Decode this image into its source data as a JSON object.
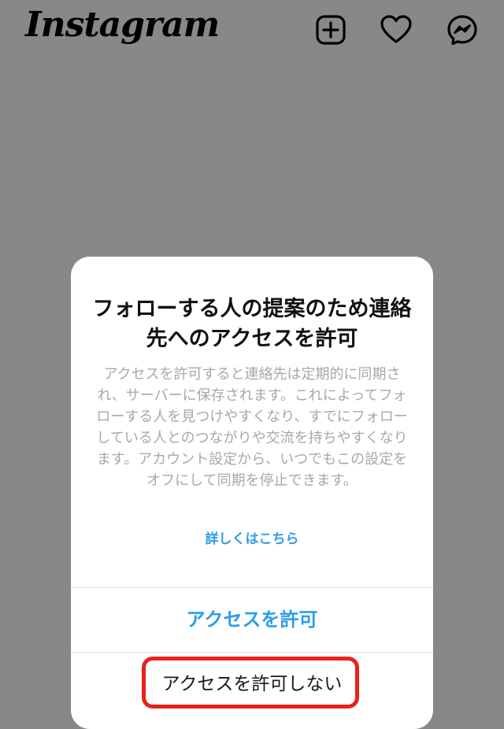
{
  "header": {
    "logo": "Instagram",
    "icons": {
      "new_post": "plus-square-icon",
      "activity": "heart-icon",
      "messages": "messenger-icon"
    }
  },
  "dialog": {
    "title": "フォローする人の提案のため連絡先へのアクセスを許可",
    "body": "アクセスを許可すると連絡先は定期的に同期され、サーバーに保存されます。これによってフォローする人を見つけやすくなり、すでにフォローしている人とのつながりや交流を持ちやすくなります。アカウント設定から、いつでもこの設定をオフにして同期を停止できます。",
    "learn_more": "詳しくはこちら",
    "allow_label": "アクセスを許可",
    "deny_label": "アクセスを許可しない"
  },
  "colors": {
    "overlay": "#888888",
    "accent": "#2d9ee8",
    "body_text": "#a8a8a8",
    "highlight": "#e8221b"
  }
}
